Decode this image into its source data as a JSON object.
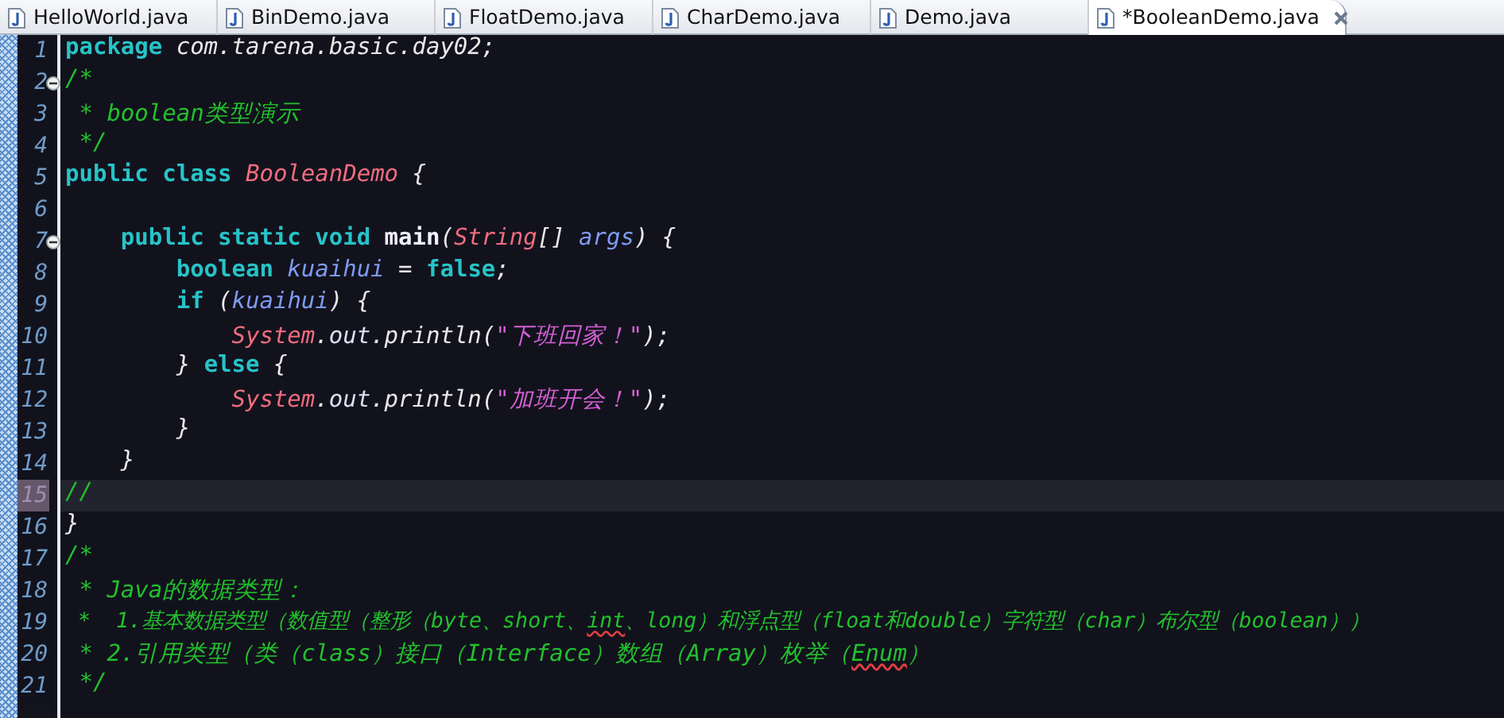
{
  "tabs": [
    {
      "label": "HelloWorld.java",
      "selected": false
    },
    {
      "label": "BinDemo.java",
      "selected": false
    },
    {
      "label": "FloatDemo.java",
      "selected": false
    },
    {
      "label": "CharDemo.java",
      "selected": false
    },
    {
      "label": "Demo.java",
      "selected": false
    },
    {
      "label": "*BooleanDemo.java",
      "selected": true
    }
  ],
  "editor": {
    "lines": [
      {
        "number": "1",
        "current": false,
        "tokens": [
          {
            "kind": "keyword",
            "text": "package"
          },
          {
            "kind": "plain",
            "text": " com.tarena.basic.day02;"
          }
        ]
      },
      {
        "number": "2",
        "current": false,
        "expanded": true,
        "tokens": [
          {
            "kind": "comment",
            "text": "/*"
          }
        ]
      },
      {
        "number": "3",
        "current": false,
        "tokens": [
          {
            "kind": "comment",
            "text": " * boolean类型演示"
          }
        ]
      },
      {
        "number": "4",
        "current": false,
        "tokens": [
          {
            "kind": "comment",
            "text": " */"
          }
        ]
      },
      {
        "number": "5",
        "current": false,
        "tokens": [
          {
            "kind": "keyword",
            "text": "public class"
          },
          {
            "kind": "type",
            "text": " BooleanDemo"
          },
          {
            "kind": "plain",
            "text": " {"
          }
        ]
      },
      {
        "number": "6",
        "current": false
      },
      {
        "number": "7",
        "current": false,
        "expanded": true,
        "tokens": [
          {
            "kind": "keyword",
            "text": "    public static void"
          },
          {
            "kind": "method",
            "text": " main"
          },
          {
            "kind": "plain",
            "text": "("
          },
          {
            "kind": "type",
            "text": "String"
          },
          {
            "kind": "plain",
            "text": "[]"
          },
          {
            "kind": "variable",
            "text": " args"
          },
          {
            "kind": "plain",
            "text": ") {"
          }
        ]
      },
      {
        "number": "8",
        "current": false,
        "tokens": [
          {
            "kind": "keyword",
            "text": "        boolean"
          },
          {
            "kind": "variable",
            "text": " kuaihui"
          },
          {
            "kind": "plain",
            "text": " = "
          },
          {
            "kind": "keyword",
            "text": "false"
          },
          {
            "kind": "plain",
            "text": ";"
          }
        ]
      },
      {
        "number": "9",
        "current": false,
        "tokens": [
          {
            "kind": "keyword",
            "text": "        if"
          },
          {
            "kind": "plain",
            "text": " ("
          },
          {
            "kind": "variable",
            "text": "kuaihui"
          },
          {
            "kind": "plain",
            "text": ") {"
          }
        ]
      },
      {
        "number": "10",
        "current": false,
        "tokens": [
          {
            "kind": "type",
            "text": "            System"
          },
          {
            "kind": "plain",
            "text": "."
          },
          {
            "kind": "field",
            "text": "out"
          },
          {
            "kind": "plain",
            "text": ".println("
          },
          {
            "kind": "string",
            "text": "\"下班回家！\""
          },
          {
            "kind": "plain",
            "text": ");"
          }
        ]
      },
      {
        "number": "11",
        "current": false,
        "tokens": [
          {
            "kind": "plain",
            "text": "        } "
          },
          {
            "kind": "keyword",
            "text": "else"
          },
          {
            "kind": "plain",
            "text": " {"
          }
        ]
      },
      {
        "number": "12",
        "current": false,
        "tokens": [
          {
            "kind": "type",
            "text": "            System"
          },
          {
            "kind": "plain",
            "text": "."
          },
          {
            "kind": "field",
            "text": "out"
          },
          {
            "kind": "plain",
            "text": ".println("
          },
          {
            "kind": "string",
            "text": "\"加班开会！\""
          },
          {
            "kind": "plain",
            "text": ");"
          }
        ]
      },
      {
        "number": "13",
        "current": false,
        "tokens": [
          {
            "kind": "plain",
            "text": "        }"
          }
        ]
      },
      {
        "number": "14",
        "current": false,
        "tokens": [
          {
            "kind": "plain",
            "text": "    }"
          }
        ]
      },
      {
        "number": "15",
        "current": true,
        "tokens": [
          {
            "kind": "comment",
            "text": "//"
          }
        ]
      },
      {
        "number": "16",
        "current": false,
        "tokens": [
          {
            "kind": "plain",
            "text": "}"
          }
        ]
      },
      {
        "number": "17",
        "current": false,
        "tokens": [
          {
            "kind": "comment",
            "text": "/*"
          }
        ]
      },
      {
        "number": "18",
        "current": false,
        "tokens": [
          {
            "kind": "comment",
            "text": " * Java的数据类型："
          }
        ]
      },
      {
        "number": "19",
        "current": false,
        "tokens": [
          {
            "kind": "comment",
            "text": " *  1.基本数据类型（数值型（整形（byte、short、"
          },
          {
            "kind": "comment-error",
            "text": "int"
          },
          {
            "kind": "comment",
            "text": "、long）和浮点型（float和double）字符型（char）布尔型（boolean））"
          }
        ]
      },
      {
        "number": "20",
        "current": false,
        "tokens": [
          {
            "kind": "comment",
            "text": " * 2.引用类型（类（class）接口（Interface）数组（Array）枚举（"
          },
          {
            "kind": "comment-error",
            "text": "Enum"
          },
          {
            "kind": "comment",
            "text": "）"
          }
        ]
      },
      {
        "number": "21",
        "current": false,
        "tokens": [
          {
            "kind": "comment",
            "text": " */"
          }
        ]
      }
    ]
  }
}
